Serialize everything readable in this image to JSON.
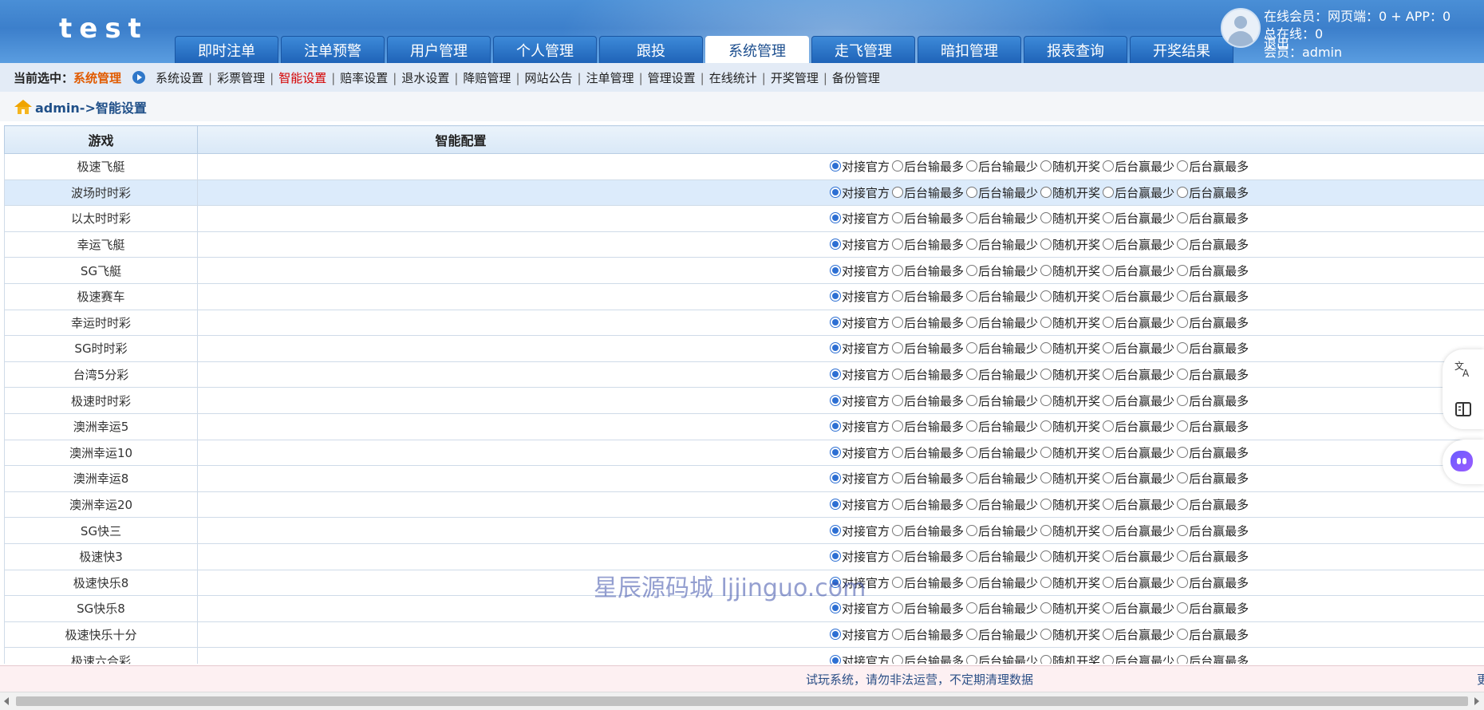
{
  "header": {
    "logo": "test",
    "tabs": [
      {
        "label": "即时注单",
        "name": "tab-instant-bets"
      },
      {
        "label": "注单预警",
        "name": "tab-bet-alerts"
      },
      {
        "label": "用户管理",
        "name": "tab-user-management"
      },
      {
        "label": "个人管理",
        "name": "tab-personal-management"
      },
      {
        "label": "跟投",
        "name": "tab-follow-bet"
      },
      {
        "label": "系统管理",
        "name": "tab-system-management",
        "active": true
      },
      {
        "label": "走飞管理",
        "name": "tab-fly-management"
      },
      {
        "label": "暗扣管理",
        "name": "tab-hidden-deduction"
      },
      {
        "label": "报表查询",
        "name": "tab-report-query"
      },
      {
        "label": "开奖结果",
        "name": "tab-draw-results"
      }
    ],
    "online_members": "在线会员：网页端：0 + APP：0",
    "total_online": "总在线：0",
    "logout": "退出",
    "user": "会员：admin"
  },
  "subnav": {
    "current_label": "当前选中：",
    "current_value": "系统管理",
    "items": [
      {
        "label": "系统设置"
      },
      {
        "label": "彩票管理"
      },
      {
        "label": "智能设置",
        "active": true
      },
      {
        "label": "赔率设置"
      },
      {
        "label": "退水设置"
      },
      {
        "label": "降赔管理"
      },
      {
        "label": "网站公告"
      },
      {
        "label": "注单管理"
      },
      {
        "label": "管理设置"
      },
      {
        "label": "在线统计"
      },
      {
        "label": "开奖管理"
      },
      {
        "label": "备份管理"
      }
    ]
  },
  "breadcrumb": "admin->智能设置",
  "table": {
    "headers": [
      "游戏",
      "智能配置"
    ],
    "options": [
      "对接官方",
      "后台输最多",
      "后台输最少",
      "随机开奖",
      "后台赢最少",
      "后台赢最多"
    ],
    "selected_option": "对接官方",
    "rows": [
      "极速飞艇",
      "波场时时彩",
      "以太时时彩",
      "幸运飞艇",
      "SG飞艇",
      "极速赛车",
      "幸运时时彩",
      "SG时时彩",
      "台湾5分彩",
      "极速时时彩",
      "澳洲幸运5",
      "澳洲幸运10",
      "澳洲幸运8",
      "澳洲幸运20",
      "SG快三",
      "极速快3",
      "极速快乐8",
      "SG快乐8",
      "极速快乐十分",
      "极速六合彩"
    ],
    "highlighted_row": 1
  },
  "footer": {
    "notice": "试玩系统，请勿非法运营，不定期清理数据",
    "more": "更"
  },
  "watermark": "星辰源码城 ljjinguo.com",
  "colors": {
    "header_blue": "#3c7fcb",
    "active_menu": "#d40000",
    "current_value": "#e15b00",
    "radio_selected": "#2d6fd3"
  }
}
